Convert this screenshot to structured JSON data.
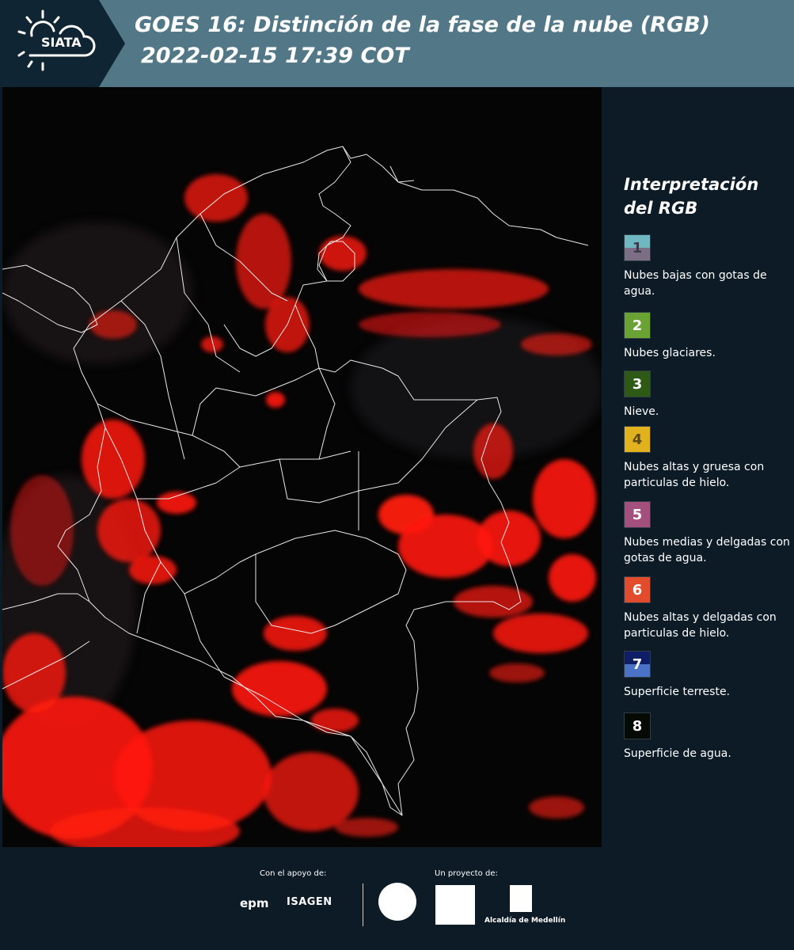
{
  "header": {
    "logo_text": "SIATA",
    "title_line1": "GOES 16: Distinción de la fase de la nube (RGB)",
    "title_line2": "2022-02-15 17:39 COT",
    "background_color": "#527787"
  },
  "legend": {
    "title_line1": "Interpretación",
    "title_line2": "del RGB",
    "items": [
      {
        "number": "1",
        "label": "Nubes bajas con gotas de agua.",
        "top_color": "#6fb7c1",
        "bottom_color": "#7b6e85",
        "number_color": "#3b3b4a"
      },
      {
        "number": "2",
        "label": "Nubes glaciares.",
        "top_color": "#6aa234",
        "bottom_color": "#6aa234",
        "number_color": "#ffffff"
      },
      {
        "number": "3",
        "label": "Nieve.",
        "top_color": "#2f5a16",
        "bottom_color": "#2f5a16",
        "number_color": "#ffffff"
      },
      {
        "number": "4",
        "label": "Nubes altas y gruesa con particulas de hielo.",
        "top_color": "#e2b11e",
        "bottom_color": "#e2b11e",
        "number_color": "#5a4a1a"
      },
      {
        "number": "5",
        "label": "Nubes medias y delgadas con gotas de agua.",
        "top_color": "#a3507e",
        "bottom_color": "#a3507e",
        "number_color": "#ffffff"
      },
      {
        "number": "6",
        "label": "Nubes altas y delgadas con particulas de hielo.",
        "top_color": "#e24b2c",
        "bottom_color": "#e24b2c",
        "number_color": "#ffffff"
      },
      {
        "number": "7",
        "label": "Superficie terreste.",
        "top_color": "#0f1e66",
        "bottom_color": "#4a73c8",
        "number_color": "#ffffff"
      },
      {
        "number": "8",
        "label": "Superficie de agua.",
        "top_color": "#050a05",
        "bottom_color": "#050a05",
        "number_color": "#ffffff"
      }
    ]
  },
  "footer": {
    "support_label": "Con el apoyo de:",
    "project_label": "Un proyecto de:",
    "sponsor_1": "epm",
    "sponsor_2": "ISAGEN",
    "partner_3": "Alcaldía de Medellín"
  },
  "colors": {
    "panel_background": "#0c1b26",
    "map_background": "#050505",
    "cloud_red": "#ff1a10",
    "border_lines": "#e8e8e8"
  }
}
